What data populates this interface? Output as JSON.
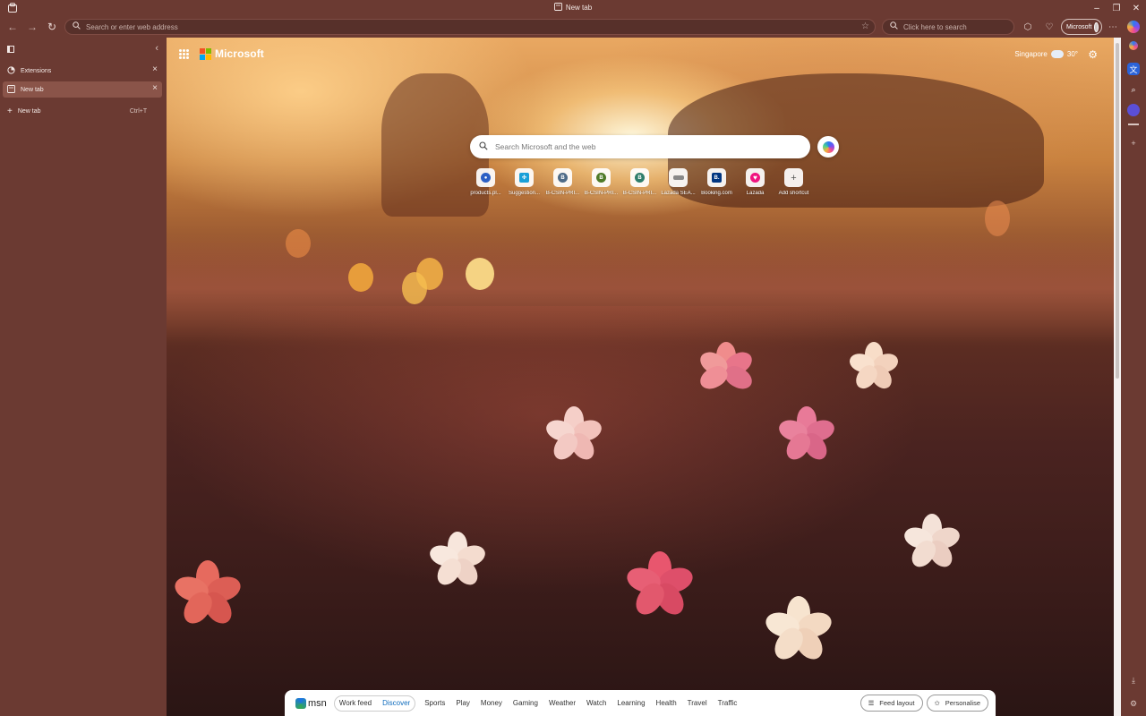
{
  "window": {
    "title": "New tab",
    "controls": [
      "minimize",
      "restore",
      "close"
    ]
  },
  "toolbar": {
    "address_placeholder": "Search or enter web address",
    "search_placeholder": "Click here to search",
    "profile_label": "Microsoft"
  },
  "tabs_panel": {
    "tabs": [
      {
        "label": "Extensions",
        "active": false
      },
      {
        "label": "New tab",
        "active": true
      }
    ],
    "new_tab_label": "New tab",
    "new_tab_shortcut": "Ctrl+T"
  },
  "newtab": {
    "brand": "Microsoft",
    "weather": {
      "location": "Singapore",
      "temp": "30°"
    },
    "search_placeholder": "Search Microsoft and the web",
    "shortcuts": [
      {
        "label": "products.pl...",
        "glyph": "",
        "color": "#2c5fc4"
      },
      {
        "label": "Suggestion...",
        "glyph": "",
        "color": "#1aa0d8"
      },
      {
        "label": "B-CSIN-PRI...",
        "glyph": "B",
        "color": "#4e6b87"
      },
      {
        "label": "B-CSIN-PRI...",
        "glyph": "B",
        "color": "#4f7a28"
      },
      {
        "label": "B-CSIN-PRI...",
        "glyph": "B",
        "color": "#2e7d6b"
      },
      {
        "label": "Lazada SEA...",
        "glyph": "",
        "color": "#888888"
      },
      {
        "label": "Booking.com",
        "glyph": "B.",
        "color": "#003580"
      },
      {
        "label": "Lazada",
        "glyph": "",
        "color": "#f0147f"
      },
      {
        "label": "Add shortcut",
        "glyph": "+",
        "color": "#ffffff"
      }
    ]
  },
  "feedbar": {
    "logo": "msn",
    "segments": [
      {
        "label": "Work feed",
        "active": false
      },
      {
        "label": "Discover",
        "active": true
      }
    ],
    "links": [
      "Sports",
      "Play",
      "Money",
      "Gaming",
      "Weather",
      "Watch",
      "Learning",
      "Health",
      "Travel",
      "Traffic"
    ],
    "feed_layout_label": "Feed layout",
    "personalise_label": "Personalise"
  },
  "colors": {
    "chrome": "#6b3a32",
    "active_tab": "#8a5449",
    "accent": "#0f6cbd"
  }
}
